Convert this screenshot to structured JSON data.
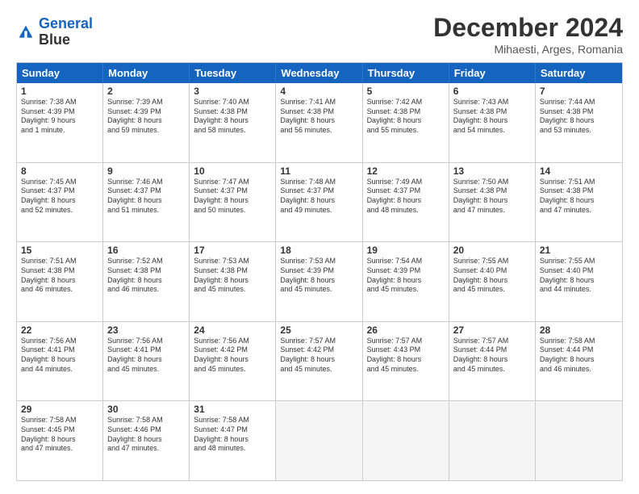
{
  "header": {
    "logo_line1": "General",
    "logo_line2": "Blue",
    "title": "December 2024",
    "location": "Mihaesti, Arges, Romania"
  },
  "days_of_week": [
    "Sunday",
    "Monday",
    "Tuesday",
    "Wednesday",
    "Thursday",
    "Friday",
    "Saturday"
  ],
  "rows": [
    [
      {
        "day": "1",
        "lines": [
          "Sunrise: 7:38 AM",
          "Sunset: 4:39 PM",
          "Daylight: 9 hours",
          "and 1 minute."
        ]
      },
      {
        "day": "2",
        "lines": [
          "Sunrise: 7:39 AM",
          "Sunset: 4:39 PM",
          "Daylight: 8 hours",
          "and 59 minutes."
        ]
      },
      {
        "day": "3",
        "lines": [
          "Sunrise: 7:40 AM",
          "Sunset: 4:38 PM",
          "Daylight: 8 hours",
          "and 58 minutes."
        ]
      },
      {
        "day": "4",
        "lines": [
          "Sunrise: 7:41 AM",
          "Sunset: 4:38 PM",
          "Daylight: 8 hours",
          "and 56 minutes."
        ]
      },
      {
        "day": "5",
        "lines": [
          "Sunrise: 7:42 AM",
          "Sunset: 4:38 PM",
          "Daylight: 8 hours",
          "and 55 minutes."
        ]
      },
      {
        "day": "6",
        "lines": [
          "Sunrise: 7:43 AM",
          "Sunset: 4:38 PM",
          "Daylight: 8 hours",
          "and 54 minutes."
        ]
      },
      {
        "day": "7",
        "lines": [
          "Sunrise: 7:44 AM",
          "Sunset: 4:38 PM",
          "Daylight: 8 hours",
          "and 53 minutes."
        ]
      }
    ],
    [
      {
        "day": "8",
        "lines": [
          "Sunrise: 7:45 AM",
          "Sunset: 4:37 PM",
          "Daylight: 8 hours",
          "and 52 minutes."
        ]
      },
      {
        "day": "9",
        "lines": [
          "Sunrise: 7:46 AM",
          "Sunset: 4:37 PM",
          "Daylight: 8 hours",
          "and 51 minutes."
        ]
      },
      {
        "day": "10",
        "lines": [
          "Sunrise: 7:47 AM",
          "Sunset: 4:37 PM",
          "Daylight: 8 hours",
          "and 50 minutes."
        ]
      },
      {
        "day": "11",
        "lines": [
          "Sunrise: 7:48 AM",
          "Sunset: 4:37 PM",
          "Daylight: 8 hours",
          "and 49 minutes."
        ]
      },
      {
        "day": "12",
        "lines": [
          "Sunrise: 7:49 AM",
          "Sunset: 4:37 PM",
          "Daylight: 8 hours",
          "and 48 minutes."
        ]
      },
      {
        "day": "13",
        "lines": [
          "Sunrise: 7:50 AM",
          "Sunset: 4:38 PM",
          "Daylight: 8 hours",
          "and 47 minutes."
        ]
      },
      {
        "day": "14",
        "lines": [
          "Sunrise: 7:51 AM",
          "Sunset: 4:38 PM",
          "Daylight: 8 hours",
          "and 47 minutes."
        ]
      }
    ],
    [
      {
        "day": "15",
        "lines": [
          "Sunrise: 7:51 AM",
          "Sunset: 4:38 PM",
          "Daylight: 8 hours",
          "and 46 minutes."
        ]
      },
      {
        "day": "16",
        "lines": [
          "Sunrise: 7:52 AM",
          "Sunset: 4:38 PM",
          "Daylight: 8 hours",
          "and 46 minutes."
        ]
      },
      {
        "day": "17",
        "lines": [
          "Sunrise: 7:53 AM",
          "Sunset: 4:38 PM",
          "Daylight: 8 hours",
          "and 45 minutes."
        ]
      },
      {
        "day": "18",
        "lines": [
          "Sunrise: 7:53 AM",
          "Sunset: 4:39 PM",
          "Daylight: 8 hours",
          "and 45 minutes."
        ]
      },
      {
        "day": "19",
        "lines": [
          "Sunrise: 7:54 AM",
          "Sunset: 4:39 PM",
          "Daylight: 8 hours",
          "and 45 minutes."
        ]
      },
      {
        "day": "20",
        "lines": [
          "Sunrise: 7:55 AM",
          "Sunset: 4:40 PM",
          "Daylight: 8 hours",
          "and 45 minutes."
        ]
      },
      {
        "day": "21",
        "lines": [
          "Sunrise: 7:55 AM",
          "Sunset: 4:40 PM",
          "Daylight: 8 hours",
          "and 44 minutes."
        ]
      }
    ],
    [
      {
        "day": "22",
        "lines": [
          "Sunrise: 7:56 AM",
          "Sunset: 4:41 PM",
          "Daylight: 8 hours",
          "and 44 minutes."
        ]
      },
      {
        "day": "23",
        "lines": [
          "Sunrise: 7:56 AM",
          "Sunset: 4:41 PM",
          "Daylight: 8 hours",
          "and 45 minutes."
        ]
      },
      {
        "day": "24",
        "lines": [
          "Sunrise: 7:56 AM",
          "Sunset: 4:42 PM",
          "Daylight: 8 hours",
          "and 45 minutes."
        ]
      },
      {
        "day": "25",
        "lines": [
          "Sunrise: 7:57 AM",
          "Sunset: 4:42 PM",
          "Daylight: 8 hours",
          "and 45 minutes."
        ]
      },
      {
        "day": "26",
        "lines": [
          "Sunrise: 7:57 AM",
          "Sunset: 4:43 PM",
          "Daylight: 8 hours",
          "and 45 minutes."
        ]
      },
      {
        "day": "27",
        "lines": [
          "Sunrise: 7:57 AM",
          "Sunset: 4:44 PM",
          "Daylight: 8 hours",
          "and 45 minutes."
        ]
      },
      {
        "day": "28",
        "lines": [
          "Sunrise: 7:58 AM",
          "Sunset: 4:44 PM",
          "Daylight: 8 hours",
          "and 46 minutes."
        ]
      }
    ],
    [
      {
        "day": "29",
        "lines": [
          "Sunrise: 7:58 AM",
          "Sunset: 4:45 PM",
          "Daylight: 8 hours",
          "and 47 minutes."
        ]
      },
      {
        "day": "30",
        "lines": [
          "Sunrise: 7:58 AM",
          "Sunset: 4:46 PM",
          "Daylight: 8 hours",
          "and 47 minutes."
        ]
      },
      {
        "day": "31",
        "lines": [
          "Sunrise: 7:58 AM",
          "Sunset: 4:47 PM",
          "Daylight: 8 hours",
          "and 48 minutes."
        ]
      },
      {
        "day": "",
        "lines": []
      },
      {
        "day": "",
        "lines": []
      },
      {
        "day": "",
        "lines": []
      },
      {
        "day": "",
        "lines": []
      }
    ]
  ]
}
